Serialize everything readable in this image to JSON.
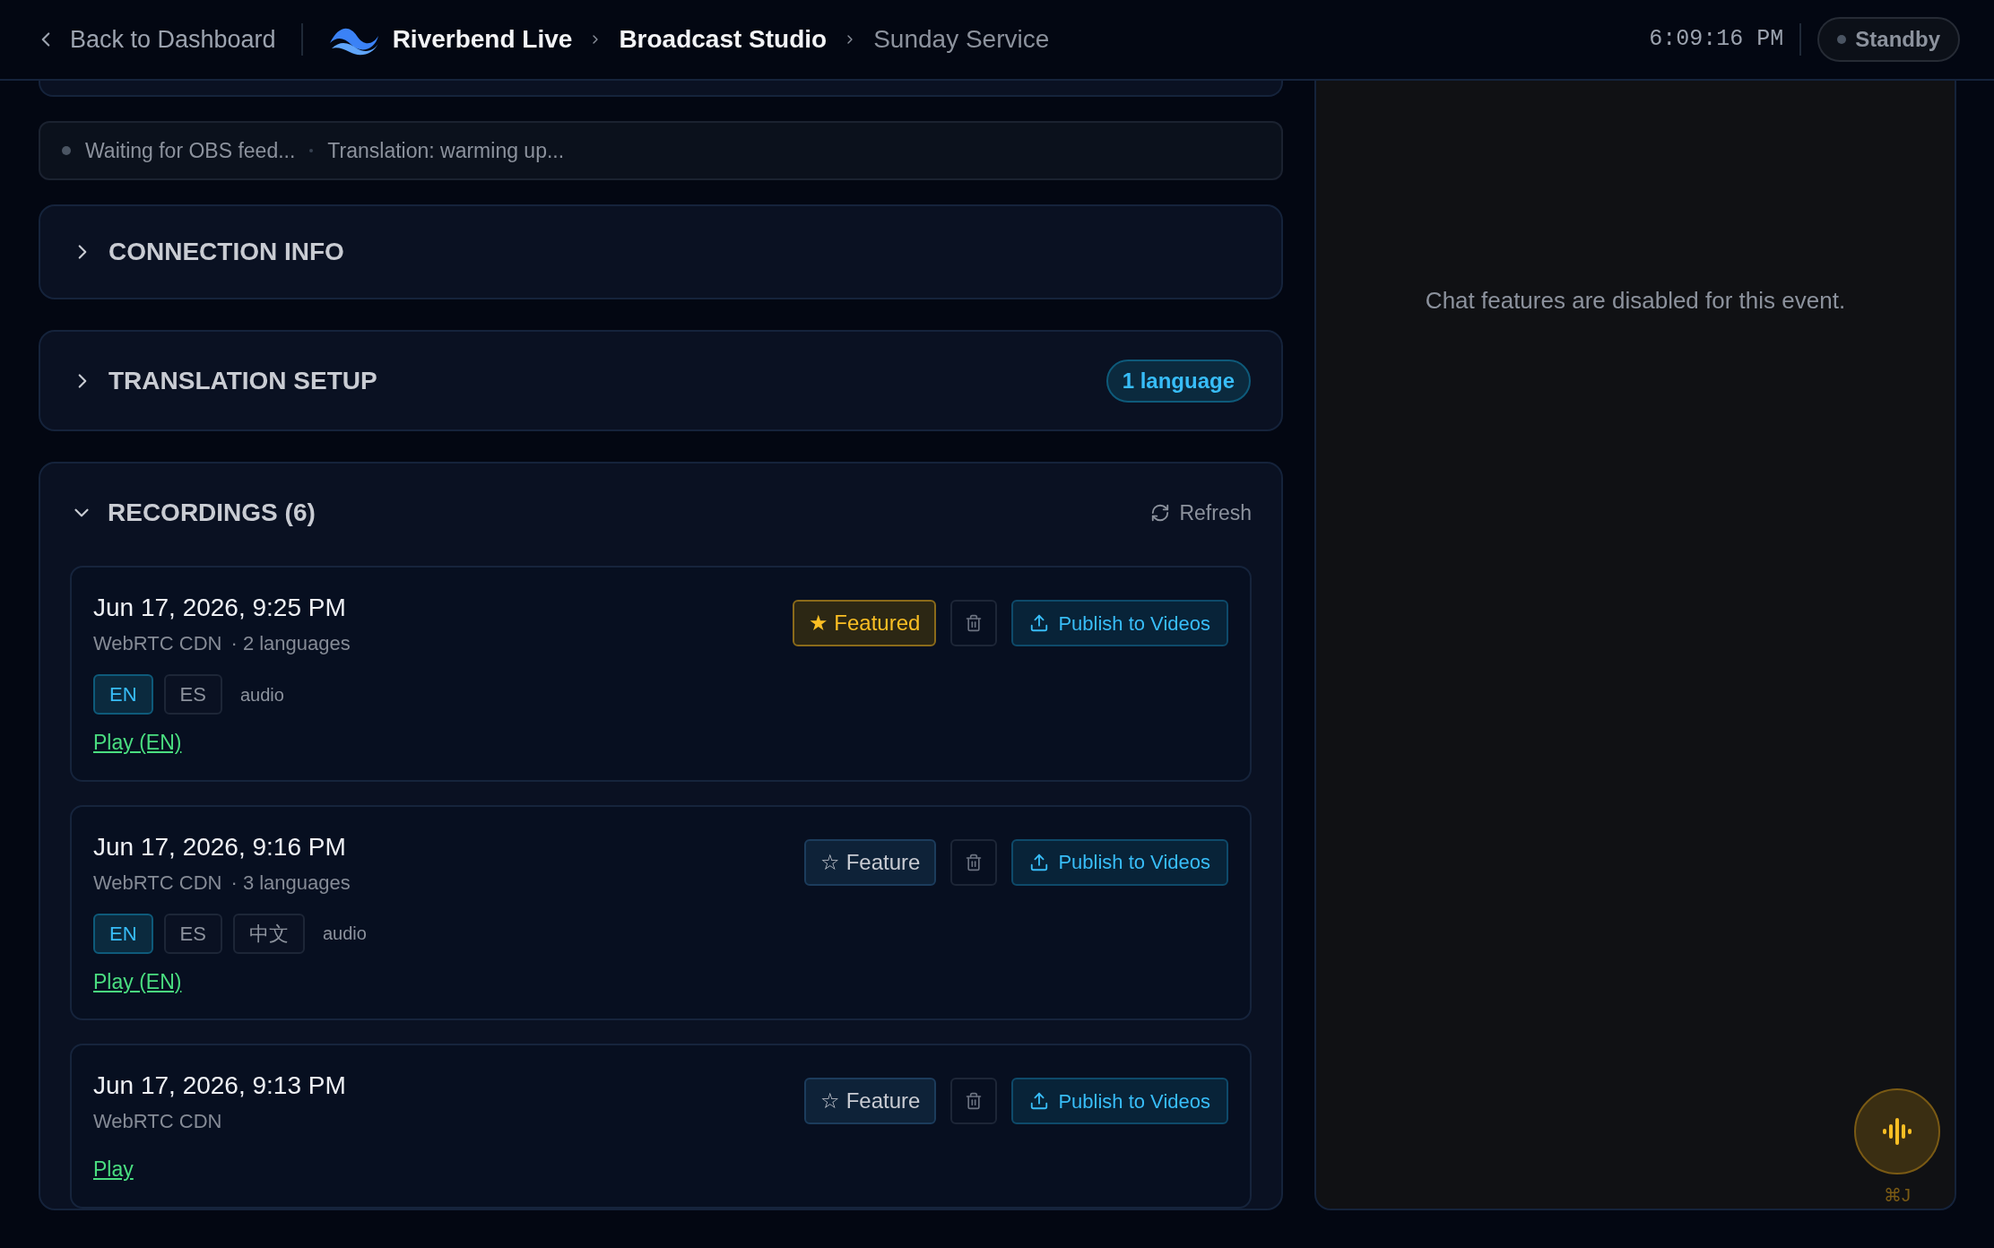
{
  "header": {
    "back_link": "Back to Dashboard",
    "breadcrumbs": [
      {
        "label": "Riverbend Live",
        "kind": "brand"
      },
      {
        "label": "Broadcast Studio",
        "kind": "current"
      },
      {
        "label": "Sunday Service",
        "kind": "muted"
      }
    ],
    "clock": "6:09:16 PM",
    "status": {
      "label": "Standby",
      "live": false
    }
  },
  "status_bar": {
    "items": [
      "Waiting for OBS feed...",
      "Translation: warming up..."
    ]
  },
  "sections": [
    {
      "title": "CONNECTION INFO",
      "expanded": false
    },
    {
      "title": "TRANSLATION SETUP",
      "expanded": false,
      "badge": "1 language"
    }
  ],
  "recordings": {
    "title": "RECORDINGS (6)",
    "expanded": true,
    "refresh": "Refresh",
    "items": [
      {
        "date": "Jun 17, 2026, 9:25 PM",
        "source": "WebRTC CDN",
        "languages": "· 2 languages",
        "featured": true,
        "feature_label": "★ Featured",
        "publish": "Publish to Videos",
        "tags": [
          {
            "kind": "language",
            "label": "EN",
            "selected": true
          },
          {
            "kind": "language",
            "label": "ES",
            "selected": false
          },
          {
            "kind": "format",
            "label": "audio"
          }
        ],
        "play": "Play (EN)"
      },
      {
        "date": "Jun 17, 2026, 9:16 PM",
        "source": "WebRTC CDN",
        "languages": "· 3 languages",
        "featured": false,
        "feature_label": "☆ Feature",
        "publish": "Publish to Videos",
        "tags": [
          {
            "kind": "language",
            "label": "EN",
            "selected": true
          },
          {
            "kind": "language",
            "label": "ES",
            "selected": false
          },
          {
            "kind": "language",
            "label": "中文",
            "selected": false
          },
          {
            "kind": "format",
            "label": "audio"
          }
        ],
        "play": "Play (EN)"
      },
      {
        "date": "Jun 17, 2026, 9:13 PM",
        "source": "WebRTC CDN",
        "featured": false,
        "feature_label": "☆ Feature",
        "publish": "Publish to Videos",
        "play": "Play"
      }
    ]
  },
  "chat": {
    "message": "Chat features are disabled for this event."
  },
  "voice_button": {
    "shortcut": "⌘J"
  }
}
